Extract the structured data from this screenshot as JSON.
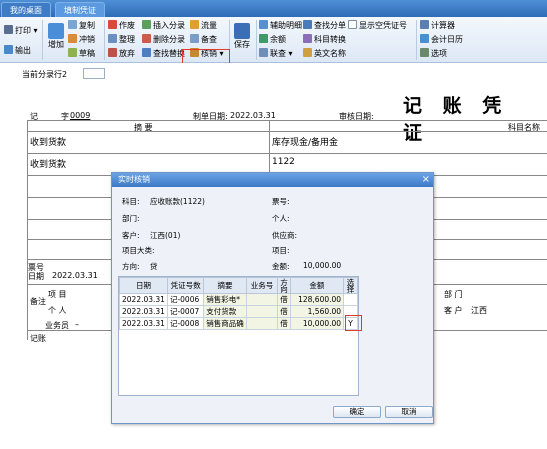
{
  "tabs": [
    "我的桌面",
    "填制凭证"
  ],
  "toolbar": {
    "print": "打印",
    "print_arrow": "▾",
    "output": "输出",
    "add": "增加",
    "copy": "复制",
    "offset": "冲销",
    "draft": "草稿",
    "void": "作废",
    "tidy": "整理",
    "abandon": "放弃",
    "insert_entry": "插入分录",
    "delete_entry": "删除分录",
    "find_replace": "查找替换",
    "flow": "流量",
    "standby": "备查",
    "verify": "核销",
    "save": "保存",
    "aux_detail": "辅助明细",
    "balance": "余额",
    "link": "联查",
    "find_entry": "查找分单",
    "account_convert": "科目转换",
    "english_name": "英文名称",
    "show_empty_voucher": "显示空凭证号",
    "calculator": "计算器",
    "calendar": "会计日历",
    "options": "选项"
  },
  "voucher": {
    "current_entry_label": "当前分录行2",
    "title": "记 账 凭 证",
    "type": "记",
    "number_prefix": "字",
    "number": "0009",
    "date_label": "制单日期:",
    "date": "2022.03.31",
    "audit_date_label": "审核日期:",
    "col_summary": "摘 要",
    "col_account": "科目名称",
    "rows": [
      {
        "summary": "收到货款",
        "account": "库存现金/备用金"
      },
      {
        "summary": "收到货款",
        "account": "1122"
      }
    ],
    "ticket_label": "票号",
    "ticket_date_label": "日期",
    "ticket_date": "2022.03.31",
    "note_label": "备注",
    "project_label": "项  目",
    "person_label": "个  人",
    "salesman_label": "业务员",
    "dept_label": "部  门",
    "customer_label": "客  户",
    "customer": "江西",
    "maker_label": "记账"
  },
  "dialog": {
    "title": "实时核销",
    "close": "×",
    "subject_label": "科目:",
    "subject": "应收账款(1122)",
    "dept_label": "部门:",
    "customer_label": "客户:",
    "customer": "江西(01)",
    "project_class_label": "项目大类:",
    "direction_label": "方向:",
    "direction": "贷",
    "ticket_label": "票号:",
    "person_label": "个人:",
    "supplier_label": "供应商:",
    "project_label": "项目:",
    "amount_label": "金额:",
    "amount": "10,000.00",
    "columns": [
      "日期",
      "凭证号数",
      "摘要",
      "业务号",
      "方向",
      "金额",
      "选择"
    ],
    "rows": [
      {
        "date": "2022.03.31",
        "voucher": "记-0006",
        "summary": "销售彩电*",
        "biz": "",
        "dir": "借",
        "amount": "128,600.00",
        "select": ""
      },
      {
        "date": "2022.03.31",
        "voucher": "记-0007",
        "summary": "支付货款",
        "biz": "",
        "dir": "借",
        "amount": "1,560.00",
        "select": ""
      },
      {
        "date": "2022.03.31",
        "voucher": "记-0008",
        "summary": "销售商品确",
        "biz": "",
        "dir": "借",
        "amount": "10,000.00",
        "select": "Y"
      }
    ],
    "ok": "确定",
    "cancel": "取消"
  }
}
